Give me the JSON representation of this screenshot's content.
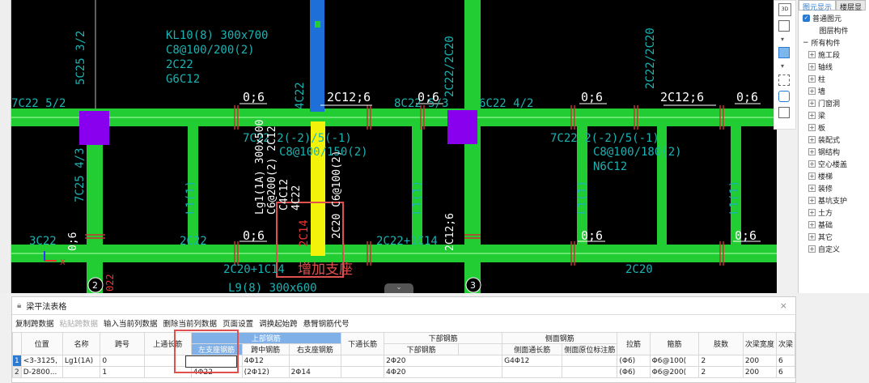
{
  "cad": {
    "labels": {
      "kl_name": "KL10(8) 300x700",
      "kl_stir": "C8@100/200(2)",
      "kl_top": "2C22",
      "kl_side": "G6C12",
      "top_a": "7C22 5/2",
      "top_b": "5C25 3/2",
      "pos_1": "0;6",
      "pos_2": "0;6",
      "pos_3": "0;6",
      "pos_4": "0;6",
      "pos_5": "0;6",
      "pos_6": "0;6",
      "pos_7": "0;6",
      "pos_8": "0;6",
      "c12_1": "2C12;6",
      "c12_2": "2C12;6",
      "c12_3": "2C12;6",
      "c4c22": "4C22",
      "c8c22": "8C22 5/3",
      "c6c22": "6C22 4/2",
      "c2c22a": "2C22/2C20",
      "c2c22b": "2C22/2C20",
      "bot_7c22_1": "7C22 2(-2)/5(-1)",
      "bot_c8_1": "C8@100/150(2)",
      "bot_7c22_2": "7C22 2(-2)/5(-1)",
      "bot_c8_2": "C8@100/180(2)",
      "bot_n6": "N6C12",
      "v_7c25": "7C25 4/3",
      "l1_1": "L1(1)",
      "l1_2": "L1(1)",
      "l1_3": "L1(1)",
      "l1_4": "L1(1)",
      "lg1": "Lg1(1A) 300x500",
      "lg1_stir": "C6@200(2) 2C12",
      "c4c12": "C4C12",
      "c4c22b": "4C22",
      "c2c20": "2C20 C6@100(2)",
      "c2c14": "2C14",
      "c2c22_b1": "2C22",
      "c2c22_b2": "2C22+1C14",
      "c2c20_b1": "2C20+1C14",
      "c2c20_b2": "2C20",
      "c3c22": "3C22",
      "l9": "L9(8) 300x600",
      "col_2": "2",
      "col_3": "3",
      "vert_022": "022",
      "annotation": "增加支座",
      "axis_x": "X"
    }
  },
  "right_panel": {
    "tab_1": "图元显示",
    "tab_2": "楼层显",
    "check_1": "普通图元",
    "section": "图层构件",
    "root": "所有构件",
    "items": [
      "施工段",
      "轴线",
      "柱",
      "墙",
      "门窗洞",
      "梁",
      "板",
      "装配式",
      "钢结构",
      "空心楼盖",
      "楼梯",
      "装修",
      "基坑支护",
      "土方",
      "基础",
      "其它",
      "自定义"
    ]
  },
  "table_panel": {
    "title": "梁平法表格",
    "close": "×",
    "toolbar": [
      "复制跨数据",
      "粘贴跨数据",
      "输入当前列数据",
      "删除当前列数据",
      "页面设置",
      "调换起始跨",
      "悬臂钢筋代号"
    ],
    "header_groups": {
      "top_rebar": "上部钢筋",
      "bottom_rebar": "下部钢筋",
      "side_rebar": "侧面钢筋"
    },
    "columns": {
      "position": "位置",
      "name": "名称",
      "span": "跨号",
      "top_long": "上通长筋",
      "left_support": "左支座钢筋",
      "mid": "跨中钢筋",
      "right_support": "右支座钢筋",
      "bot_long": "下通长筋",
      "bot_rebar": "下部钢筋",
      "side_long": "侧面通长筋",
      "side_orig": "侧面原位标注筋",
      "tie": "拉筋",
      "stirrup": "箍筋",
      "legs": "肢数",
      "sec_width": "次梁宽度",
      "sec_more": "次梁"
    },
    "rows": [
      {
        "idx": "1",
        "position": "<3-3125,",
        "name": "Lg1(1A)",
        "span": "0",
        "top_long": "",
        "left_support": "",
        "mid": "4Φ12",
        "right_support": "",
        "bot_long": "",
        "bot_rebar": "2Φ20",
        "side_long": "G4Φ12",
        "side_orig": "",
        "tie": "(Φ6)",
        "stirrup": "Φ6@100(",
        "legs": "2",
        "sec_width": "200",
        "sec_more": "6"
      },
      {
        "idx": "2",
        "position": "D-2800...",
        "name": "",
        "span": "1",
        "top_long": "",
        "left_support": "4Φ22",
        "mid": "(2Φ12)",
        "right_support": "2Φ14",
        "bot_long": "",
        "bot_rebar": "4Φ20",
        "side_long": "",
        "side_orig": "",
        "tie": "(Φ6)",
        "stirrup": "Φ6@200(",
        "legs": "2",
        "sec_width": "200",
        "sec_more": "6"
      }
    ]
  }
}
